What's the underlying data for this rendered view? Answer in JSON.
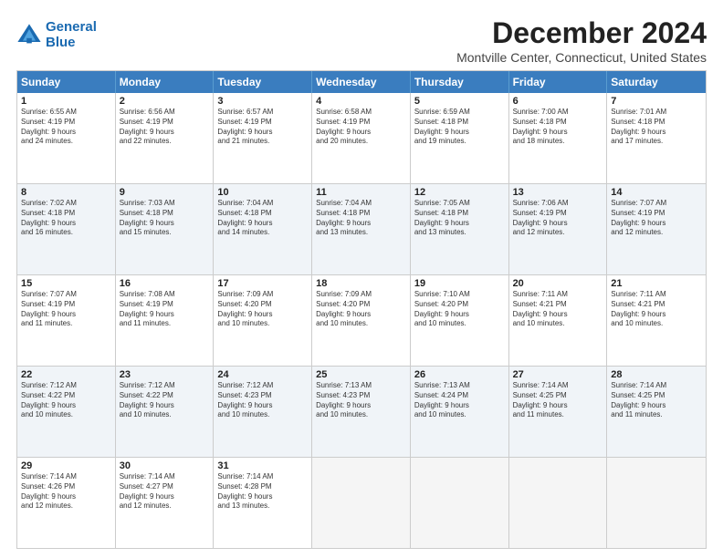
{
  "logo": {
    "line1": "General",
    "line2": "Blue"
  },
  "title": "December 2024",
  "subtitle": "Montville Center, Connecticut, United States",
  "header_days": [
    "Sunday",
    "Monday",
    "Tuesday",
    "Wednesday",
    "Thursday",
    "Friday",
    "Saturday"
  ],
  "weeks": [
    [
      {
        "day": "1",
        "lines": [
          "Sunrise: 6:55 AM",
          "Sunset: 4:19 PM",
          "Daylight: 9 hours",
          "and 24 minutes."
        ]
      },
      {
        "day": "2",
        "lines": [
          "Sunrise: 6:56 AM",
          "Sunset: 4:19 PM",
          "Daylight: 9 hours",
          "and 22 minutes."
        ]
      },
      {
        "day": "3",
        "lines": [
          "Sunrise: 6:57 AM",
          "Sunset: 4:19 PM",
          "Daylight: 9 hours",
          "and 21 minutes."
        ]
      },
      {
        "day": "4",
        "lines": [
          "Sunrise: 6:58 AM",
          "Sunset: 4:19 PM",
          "Daylight: 9 hours",
          "and 20 minutes."
        ]
      },
      {
        "day": "5",
        "lines": [
          "Sunrise: 6:59 AM",
          "Sunset: 4:18 PM",
          "Daylight: 9 hours",
          "and 19 minutes."
        ]
      },
      {
        "day": "6",
        "lines": [
          "Sunrise: 7:00 AM",
          "Sunset: 4:18 PM",
          "Daylight: 9 hours",
          "and 18 minutes."
        ]
      },
      {
        "day": "7",
        "lines": [
          "Sunrise: 7:01 AM",
          "Sunset: 4:18 PM",
          "Daylight: 9 hours",
          "and 17 minutes."
        ]
      }
    ],
    [
      {
        "day": "8",
        "lines": [
          "Sunrise: 7:02 AM",
          "Sunset: 4:18 PM",
          "Daylight: 9 hours",
          "and 16 minutes."
        ]
      },
      {
        "day": "9",
        "lines": [
          "Sunrise: 7:03 AM",
          "Sunset: 4:18 PM",
          "Daylight: 9 hours",
          "and 15 minutes."
        ]
      },
      {
        "day": "10",
        "lines": [
          "Sunrise: 7:04 AM",
          "Sunset: 4:18 PM",
          "Daylight: 9 hours",
          "and 14 minutes."
        ]
      },
      {
        "day": "11",
        "lines": [
          "Sunrise: 7:04 AM",
          "Sunset: 4:18 PM",
          "Daylight: 9 hours",
          "and 13 minutes."
        ]
      },
      {
        "day": "12",
        "lines": [
          "Sunrise: 7:05 AM",
          "Sunset: 4:18 PM",
          "Daylight: 9 hours",
          "and 13 minutes."
        ]
      },
      {
        "day": "13",
        "lines": [
          "Sunrise: 7:06 AM",
          "Sunset: 4:19 PM",
          "Daylight: 9 hours",
          "and 12 minutes."
        ]
      },
      {
        "day": "14",
        "lines": [
          "Sunrise: 7:07 AM",
          "Sunset: 4:19 PM",
          "Daylight: 9 hours",
          "and 12 minutes."
        ]
      }
    ],
    [
      {
        "day": "15",
        "lines": [
          "Sunrise: 7:07 AM",
          "Sunset: 4:19 PM",
          "Daylight: 9 hours",
          "and 11 minutes."
        ]
      },
      {
        "day": "16",
        "lines": [
          "Sunrise: 7:08 AM",
          "Sunset: 4:19 PM",
          "Daylight: 9 hours",
          "and 11 minutes."
        ]
      },
      {
        "day": "17",
        "lines": [
          "Sunrise: 7:09 AM",
          "Sunset: 4:20 PM",
          "Daylight: 9 hours",
          "and 10 minutes."
        ]
      },
      {
        "day": "18",
        "lines": [
          "Sunrise: 7:09 AM",
          "Sunset: 4:20 PM",
          "Daylight: 9 hours",
          "and 10 minutes."
        ]
      },
      {
        "day": "19",
        "lines": [
          "Sunrise: 7:10 AM",
          "Sunset: 4:20 PM",
          "Daylight: 9 hours",
          "and 10 minutes."
        ]
      },
      {
        "day": "20",
        "lines": [
          "Sunrise: 7:11 AM",
          "Sunset: 4:21 PM",
          "Daylight: 9 hours",
          "and 10 minutes."
        ]
      },
      {
        "day": "21",
        "lines": [
          "Sunrise: 7:11 AM",
          "Sunset: 4:21 PM",
          "Daylight: 9 hours",
          "and 10 minutes."
        ]
      }
    ],
    [
      {
        "day": "22",
        "lines": [
          "Sunrise: 7:12 AM",
          "Sunset: 4:22 PM",
          "Daylight: 9 hours",
          "and 10 minutes."
        ]
      },
      {
        "day": "23",
        "lines": [
          "Sunrise: 7:12 AM",
          "Sunset: 4:22 PM",
          "Daylight: 9 hours",
          "and 10 minutes."
        ]
      },
      {
        "day": "24",
        "lines": [
          "Sunrise: 7:12 AM",
          "Sunset: 4:23 PM",
          "Daylight: 9 hours",
          "and 10 minutes."
        ]
      },
      {
        "day": "25",
        "lines": [
          "Sunrise: 7:13 AM",
          "Sunset: 4:23 PM",
          "Daylight: 9 hours",
          "and 10 minutes."
        ]
      },
      {
        "day": "26",
        "lines": [
          "Sunrise: 7:13 AM",
          "Sunset: 4:24 PM",
          "Daylight: 9 hours",
          "and 10 minutes."
        ]
      },
      {
        "day": "27",
        "lines": [
          "Sunrise: 7:14 AM",
          "Sunset: 4:25 PM",
          "Daylight: 9 hours",
          "and 11 minutes."
        ]
      },
      {
        "day": "28",
        "lines": [
          "Sunrise: 7:14 AM",
          "Sunset: 4:25 PM",
          "Daylight: 9 hours",
          "and 11 minutes."
        ]
      }
    ],
    [
      {
        "day": "29",
        "lines": [
          "Sunrise: 7:14 AM",
          "Sunset: 4:26 PM",
          "Daylight: 9 hours",
          "and 12 minutes."
        ]
      },
      {
        "day": "30",
        "lines": [
          "Sunrise: 7:14 AM",
          "Sunset: 4:27 PM",
          "Daylight: 9 hours",
          "and 12 minutes."
        ]
      },
      {
        "day": "31",
        "lines": [
          "Sunrise: 7:14 AM",
          "Sunset: 4:28 PM",
          "Daylight: 9 hours",
          "and 13 minutes."
        ]
      },
      {
        "day": "",
        "lines": []
      },
      {
        "day": "",
        "lines": []
      },
      {
        "day": "",
        "lines": []
      },
      {
        "day": "",
        "lines": []
      }
    ]
  ]
}
